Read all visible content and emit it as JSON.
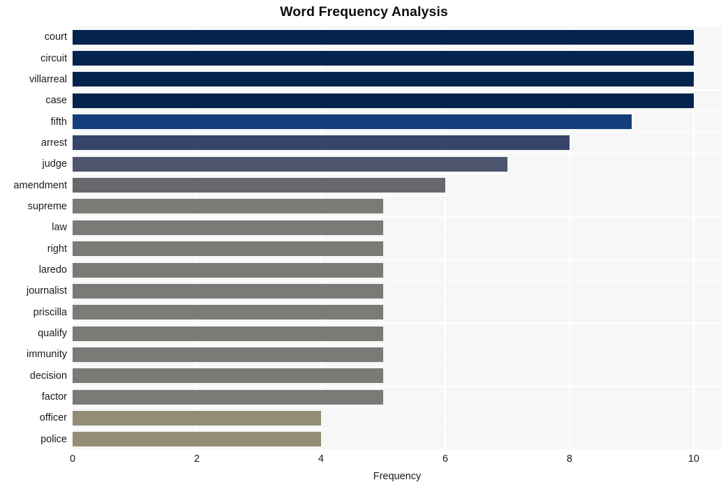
{
  "chart_data": {
    "type": "bar",
    "orientation": "horizontal",
    "title": "Word Frequency Analysis",
    "xlabel": "Frequency",
    "ylabel": "",
    "xlim": [
      0,
      10.45
    ],
    "xticks": [
      0,
      2,
      4,
      6,
      8,
      10
    ],
    "xtick_labels": [
      "0",
      "2",
      "4",
      "6",
      "8",
      "10"
    ],
    "grid": "both-white-on-light-gray",
    "legend": "none",
    "categories": [
      "court",
      "circuit",
      "villarreal",
      "case",
      "fifth",
      "arrest",
      "judge",
      "amendment",
      "supreme",
      "law",
      "right",
      "laredo",
      "journalist",
      "priscilla",
      "qualify",
      "immunity",
      "decision",
      "factor",
      "officer",
      "police"
    ],
    "values": [
      10,
      10,
      10,
      10,
      9,
      8,
      7,
      6,
      5,
      5,
      5,
      5,
      5,
      5,
      5,
      5,
      5,
      5,
      4,
      4
    ],
    "bar_colors": [
      "#04234f",
      "#04234f",
      "#04234f",
      "#04234f",
      "#143d7d",
      "#37446b",
      "#4d566e",
      "#66686e",
      "#7b7a77",
      "#7b7a77",
      "#7b7a77",
      "#7b7a77",
      "#7b7a77",
      "#7b7a77",
      "#7b7a77",
      "#7b7a77",
      "#7b7a77",
      "#7b7a77",
      "#938d76",
      "#938d76"
    ]
  },
  "style": {
    "figure_background": "#ffffff",
    "plot_background": "#f7f7f7",
    "grid_color": "#ffffff",
    "title_color": "#0d0d0d",
    "tick_color": "#1a1a1a"
  }
}
